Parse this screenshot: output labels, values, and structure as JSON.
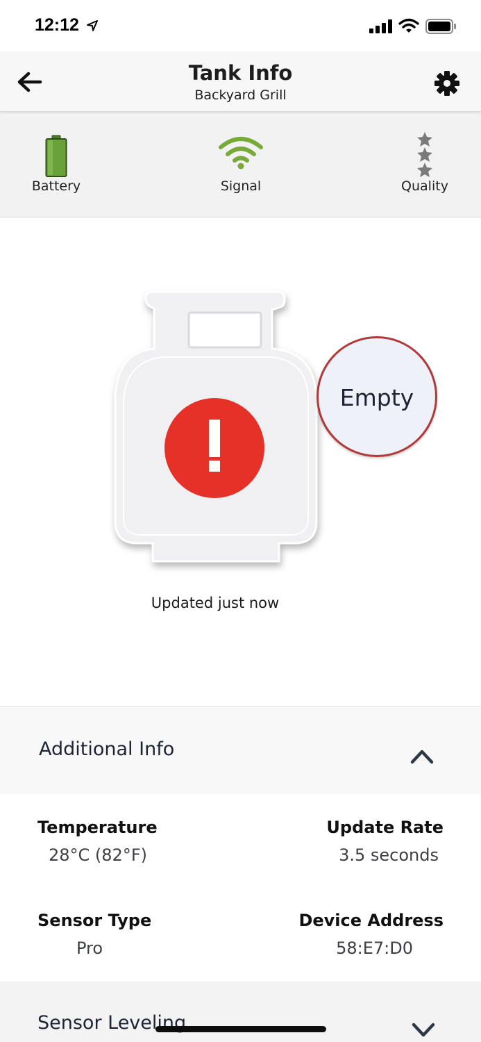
{
  "status_bar": {
    "time": "12:12"
  },
  "nav": {
    "title": "Tank Info",
    "subtitle": "Backyard Grill"
  },
  "metrics": {
    "battery": {
      "label": "Battery",
      "level": 1.0,
      "color": "#6aa23a"
    },
    "signal": {
      "label": "Signal",
      "bars": 3,
      "color": "#78aa39"
    },
    "quality": {
      "label": "Quality",
      "stars": 3,
      "color": "#7a7a7a"
    }
  },
  "tank": {
    "status_label": "Empty",
    "alert_icon": "exclamation-icon",
    "alert_color": "#e53127",
    "ring_color": "#b2393a",
    "updated_text": "Updated just now"
  },
  "additional_info": {
    "title": "Additional Info",
    "expanded": true,
    "temperature_label": "Temperature",
    "temperature_value": "28°C (82°F)",
    "update_rate_label": "Update Rate",
    "update_rate_value": "3.5 seconds",
    "sensor_type_label": "Sensor Type",
    "sensor_type_value": "Pro",
    "device_address_label": "Device Address",
    "device_address_value": "58:E7:D0"
  },
  "sensor_leveling": {
    "title": "Sensor Leveling",
    "expanded": false
  }
}
